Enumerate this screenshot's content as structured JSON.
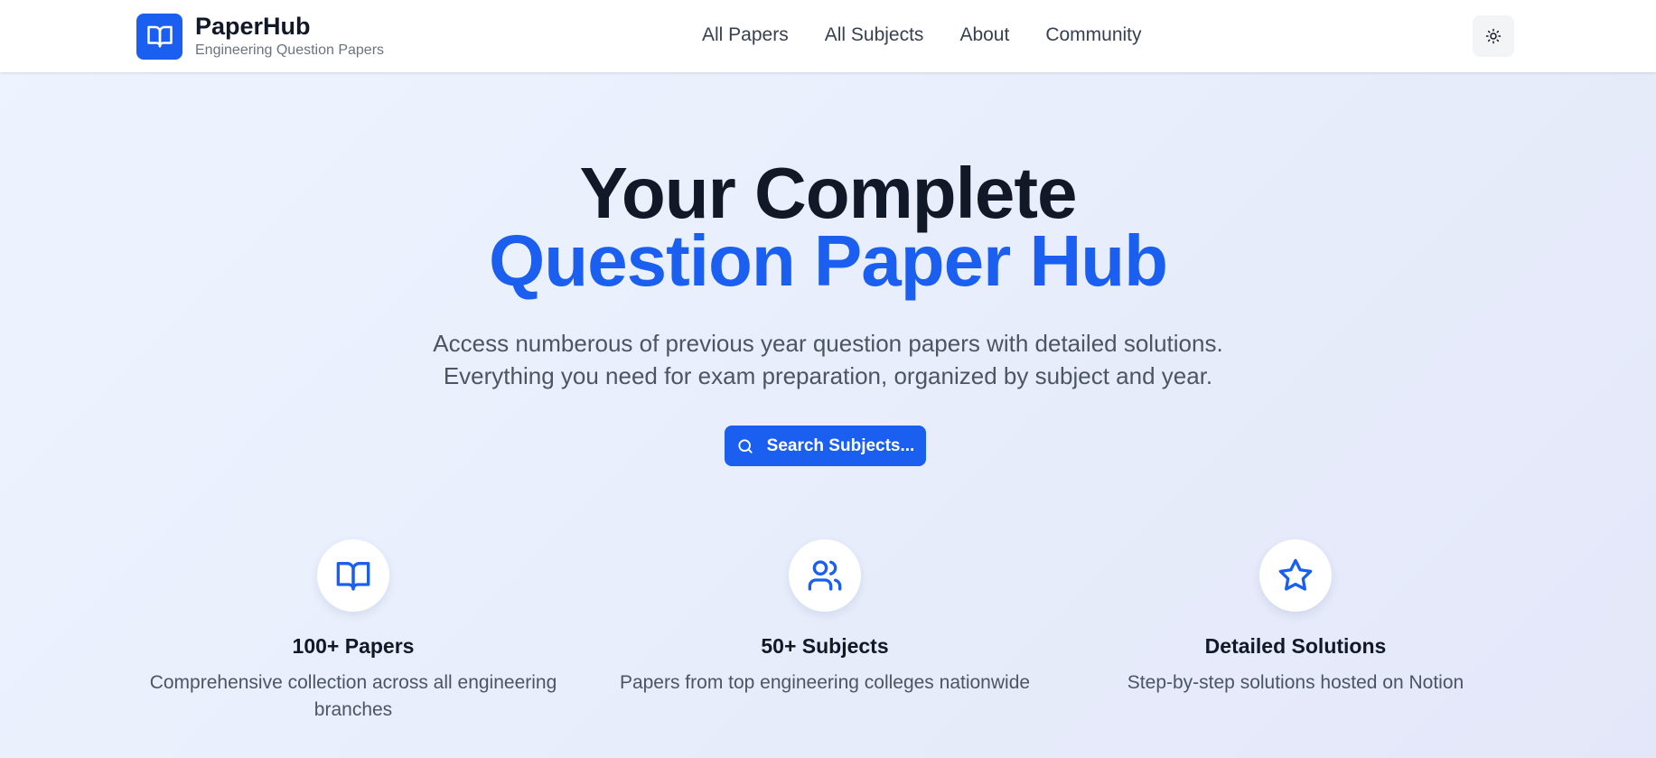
{
  "brand": {
    "name": "PaperHub",
    "tagline": "Engineering Question Papers",
    "color": "#1a5ff0"
  },
  "nav": {
    "links": [
      "All Papers",
      "All Subjects",
      "About",
      "Community"
    ],
    "theme_toggle_icon": "sun-icon"
  },
  "hero": {
    "title_line1": "Your Complete",
    "title_line2": "Question Paper Hub",
    "subtitle_line1": "Access numberous of previous year question papers with detailed solutions.",
    "subtitle_line2": "Everything you need for exam preparation, organized by subject and year.",
    "search_button_label": "Search Subjects...",
    "search_icon": "search-icon"
  },
  "features": [
    {
      "icon": "book-open-icon",
      "title": "100+ Papers",
      "description": "Comprehensive collection across all engineering branches"
    },
    {
      "icon": "users-icon",
      "title": "50+ Subjects",
      "description": "Papers from top engineering colleges nationwide"
    },
    {
      "icon": "star-icon",
      "title": "Detailed Solutions",
      "description": "Step-by-step solutions hosted on Notion"
    }
  ],
  "colors": {
    "accent": "#1a5ff0",
    "text_dark": "#111827",
    "text_muted": "#4b5563"
  }
}
